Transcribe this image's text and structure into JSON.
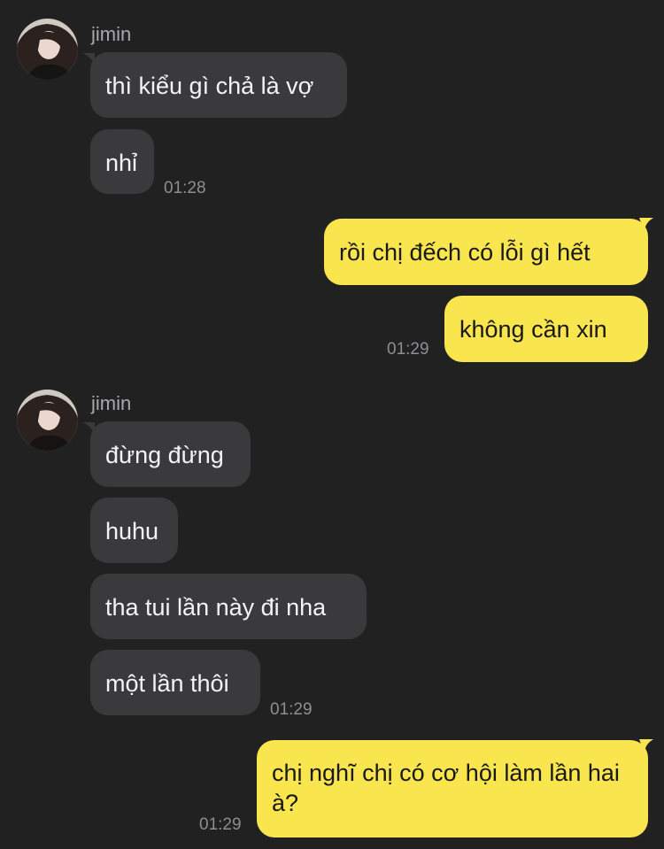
{
  "colors": {
    "background": "#212122",
    "incoming_bubble": "#3a3a3c",
    "outgoing_bubble": "#f9e54d",
    "timestamp": "#8e8e93"
  },
  "messages": {
    "group1": {
      "sender": "jimin",
      "bubble1": "thì kiểu gì chả là vợ",
      "bubble2": "nhỉ",
      "time": "01:28"
    },
    "group2": {
      "bubble1": "rồi chị đếch có lỗi gì hết",
      "bubble2": "không cần xin",
      "time": "01:29"
    },
    "group3": {
      "sender": "jimin",
      "bubble1": "đừng đừng",
      "bubble2": "huhu",
      "bubble3": "tha tui lần này đi nha",
      "bubble4": "một lần thôi",
      "time": "01:29"
    },
    "group4": {
      "bubble1": "chị nghĩ chị có cơ hội làm lần hai à?",
      "time": "01:29"
    }
  }
}
